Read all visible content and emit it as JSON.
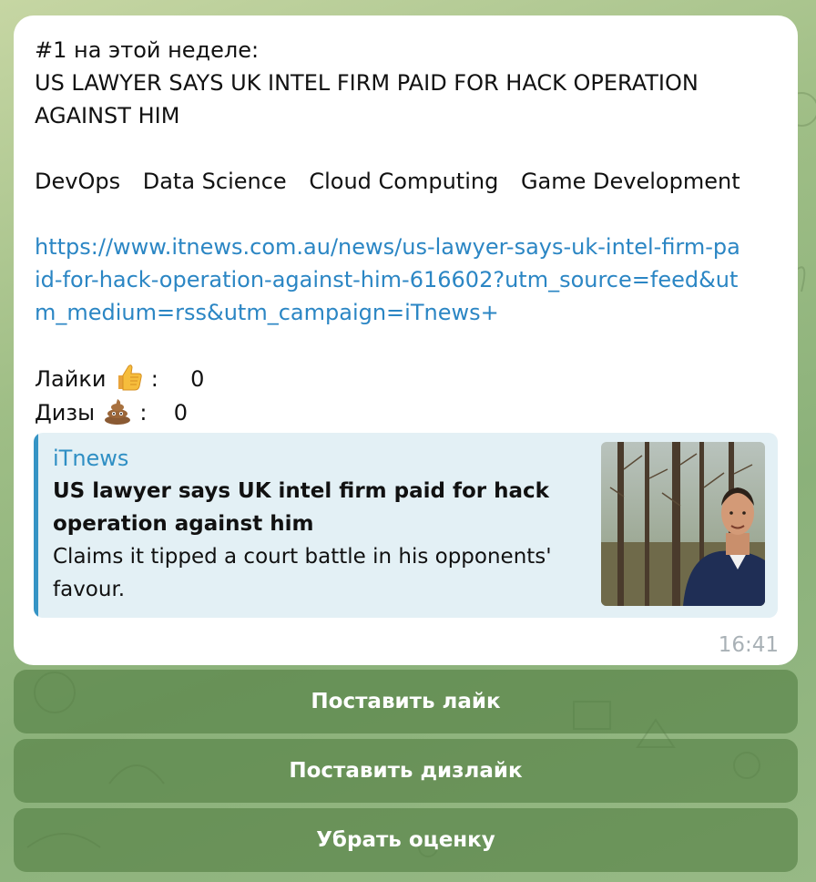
{
  "message": {
    "header": "#1 на этой неделе:",
    "headline_line1": "US LAWYER SAYS UK INTEL FIRM PAID FOR HACK OPERATION",
    "headline_line2": "AGAINST HIM",
    "tags": [
      "DevOps",
      "Data Science",
      "Cloud Computing",
      "Game Development"
    ],
    "link": "https://www.itnews.com.au/news/us-lawyer-says-uk-intel-firm-paid-for-hack-operation-against-him-616602?utm_source=feed&utm_medium=rss&utm_campaign=iTnews+",
    "likes_label": "Лайки",
    "likes_sep": ":",
    "likes_count": "0",
    "dislikes_label": "Дизы",
    "dislikes_sep": ":",
    "dislikes_count": "0",
    "time": "16:41"
  },
  "preview": {
    "site": "iTnews",
    "title": "US lawyer says UK intel firm paid for hack operation against him",
    "description": "Claims it tipped a court battle in his opponents' favour."
  },
  "keyboard": {
    "like": "Поставить лайк",
    "dislike": "Поставить дизлайк",
    "reset": "Убрать оценку"
  },
  "colors": {
    "link": "#2b86c4",
    "accent": "#3594c5",
    "button_bg": "#6e955c",
    "bubble": "#ffffff"
  },
  "icons": {
    "likes": "thumbs-up-icon",
    "dislikes": "pile-of-poo-icon"
  }
}
